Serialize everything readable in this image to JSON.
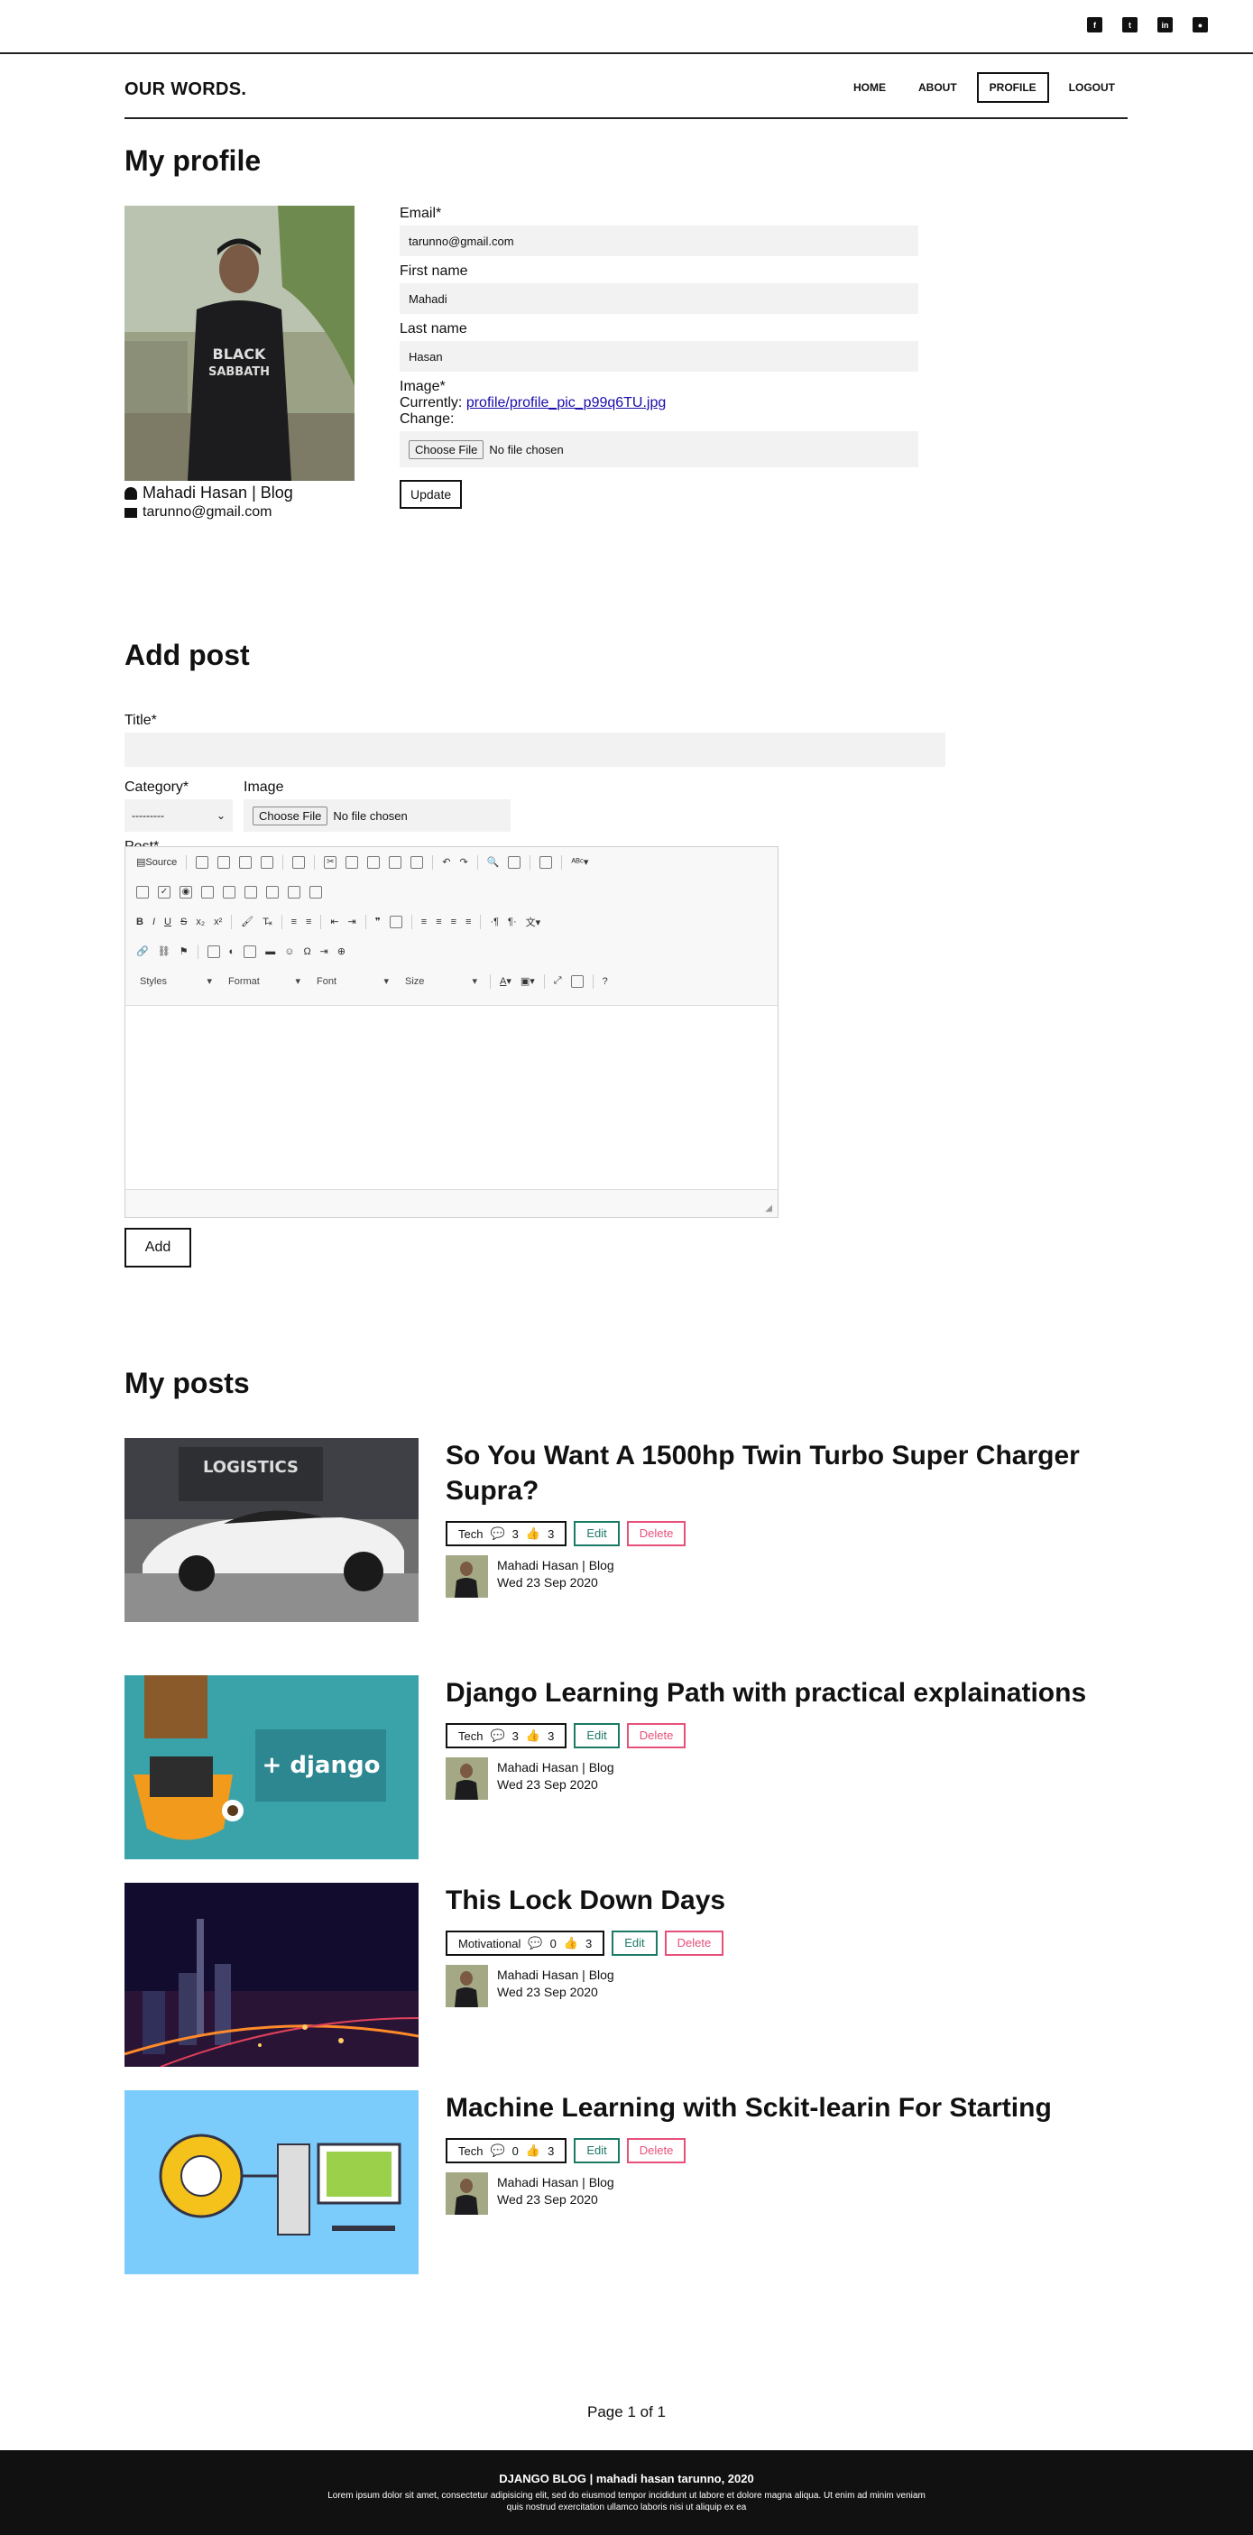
{
  "social": [
    "facebook",
    "twitter",
    "linkedin",
    "github"
  ],
  "brand": "OUR WORDS.",
  "nav": {
    "home": "HOME",
    "about": "ABOUT",
    "profile": "PROFILE",
    "logout": "LOGOUT"
  },
  "profile": {
    "heading": "My profile",
    "name": "Mahadi Hasan | Blog",
    "email": "tarunno@gmail.com",
    "form": {
      "email_label": "Email*",
      "email_value": "tarunno@gmail.com",
      "first_label": "First name",
      "first_value": "Mahadi",
      "last_label": "Last name",
      "last_value": "Hasan",
      "image_label": "Image*",
      "currently_label": "Currently:",
      "currently_value": "profile/profile_pic_p99q6TU.jpg",
      "change_label": "Change:",
      "choose_file": "Choose File",
      "no_file": "No file chosen",
      "submit": "Update"
    }
  },
  "add_post": {
    "heading": "Add post",
    "title_label": "Title*",
    "category_label": "Category*",
    "category_value": "---------",
    "image_label": "Image",
    "choose_file": "Choose File",
    "no_file": "No file chosen",
    "post_label": "Post*",
    "editor": {
      "source": "Source",
      "styles": "Styles",
      "format": "Format",
      "font": "Font",
      "size": "Size"
    },
    "submit": "Add"
  },
  "posts": {
    "heading": "My posts",
    "edit_label": "Edit",
    "delete_label": "Delete",
    "items": [
      {
        "title": "So You Want A 1500hp Twin Turbo Super Charger Supra?",
        "category": "Tech",
        "comments": "3",
        "likes": "3",
        "author": "Mahadi Hasan | Blog",
        "date": "Wed 23 Sep 2020"
      },
      {
        "title": "Django Learning Path with practical explainations",
        "category": "Tech",
        "comments": "3",
        "likes": "3",
        "author": "Mahadi Hasan | Blog",
        "date": "Wed 23 Sep 2020"
      },
      {
        "title": "This Lock Down Days",
        "category": "Motivational",
        "comments": "0",
        "likes": "3",
        "author": "Mahadi Hasan | Blog",
        "date": "Wed 23 Sep 2020"
      },
      {
        "title": "Machine Learning with Sckit-learin For Starting",
        "category": "Tech",
        "comments": "0",
        "likes": "3",
        "author": "Mahadi Hasan | Blog",
        "date": "Wed 23 Sep 2020"
      }
    ]
  },
  "pagination": "Page 1 of 1",
  "footer": {
    "title": "DJANGO BLOG | mahadi hasan tarunno, 2020",
    "text1": "Lorem ipsum dolor sit amet, consectetur adipisicing elit, sed do eiusmod tempor incididunt ut labore et dolore magna aliqua. Ut enim ad minim veniam",
    "text2": "quis nostrud exercitation ullamco laboris nisi ut aliquip ex ea"
  },
  "colors": {
    "edit": "#1b7a66",
    "delete": "#e8507a",
    "footer_bg": "#111111"
  }
}
